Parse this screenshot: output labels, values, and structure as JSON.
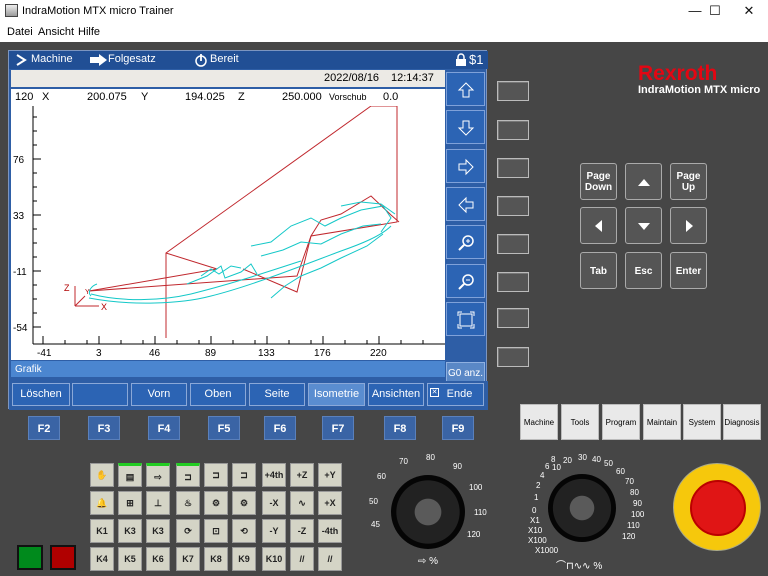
{
  "window": {
    "title": "IndraMotion MTX micro Trainer",
    "minimize": "—",
    "maximize": "☐",
    "close": "✕"
  },
  "menu": [
    "Datei",
    "Ansicht",
    "Hilfe"
  ],
  "status": {
    "mode": "Machine",
    "program": "Folgesatz",
    "state": "Bereit",
    "channel": "$1"
  },
  "datetime": {
    "date": "2022/08/16",
    "time": "12:14:37"
  },
  "coords": {
    "x_label": "X",
    "x": "200.075",
    "y_label": "Y",
    "y": "194.025",
    "z_label": "Z",
    "z": "250.000",
    "feed_label": "Vorschub",
    "feed": "0.0",
    "y_top": "120"
  },
  "graph": {
    "y_ticks": [
      "76",
      "33",
      "-11",
      "-54"
    ],
    "x_ticks": [
      "-41",
      "3",
      "46",
      "89",
      "133",
      "176",
      "220"
    ],
    "axis_z": "Z",
    "axis_x": "X",
    "axis_y": "Y",
    "colors": {
      "rapid": "#c0282e",
      "feed": "#14c8c8",
      "axes": "#b00000"
    }
  },
  "panel_label": "Grafik",
  "g0_button": "G0 anz.",
  "right_buttons": [
    "arrow-up-icon",
    "arrow-down-icon",
    "arrow-right-icon",
    "arrow-left-icon",
    "zoom-in-icon",
    "zoom-out-icon",
    "fit-icon"
  ],
  "softkeys": [
    "Löschen",
    "",
    "Vorn",
    "Oben",
    "Seite",
    "Isometrie",
    "Ansichten",
    "Ende"
  ],
  "fkeys": [
    "F2",
    "F3",
    "F4",
    "F5",
    "F6",
    "F7",
    "F8",
    "F9"
  ],
  "brand": {
    "name": "Rexroth",
    "product": "IndraMotion MTX micro",
    "color": "#e40613"
  },
  "nav_keys": {
    "page_down": "Page Down",
    "page_up": "Page Up",
    "tab": "Tab",
    "esc": "Esc",
    "enter": "Enter"
  },
  "mode_keys": [
    "Machine",
    "Tools",
    "Program",
    "Maintain",
    "System",
    "Diagnosis"
  ],
  "jog_keys": [
    "+4th",
    "+Z",
    "+Y",
    "-X",
    "+X",
    "-Y",
    "-Z",
    "-4th",
    "K10"
  ],
  "k_keys": [
    "K1",
    "K3",
    "K3",
    "K4",
    "K5",
    "K6",
    "K7",
    "K8",
    "K9"
  ],
  "dial1": {
    "labels": [
      "45",
      "50",
      "60",
      "70",
      "80",
      "90",
      "100",
      "110",
      "120"
    ],
    "unit": "%"
  },
  "dial2": {
    "labels": [
      "0",
      "1",
      "2",
      "4",
      "6",
      "8",
      "10",
      "20",
      "30",
      "40",
      "50",
      "60",
      "70",
      "80",
      "90",
      "100",
      "110",
      "120",
      "X1",
      "X10",
      "X100",
      "X1000"
    ],
    "unit": "%"
  }
}
